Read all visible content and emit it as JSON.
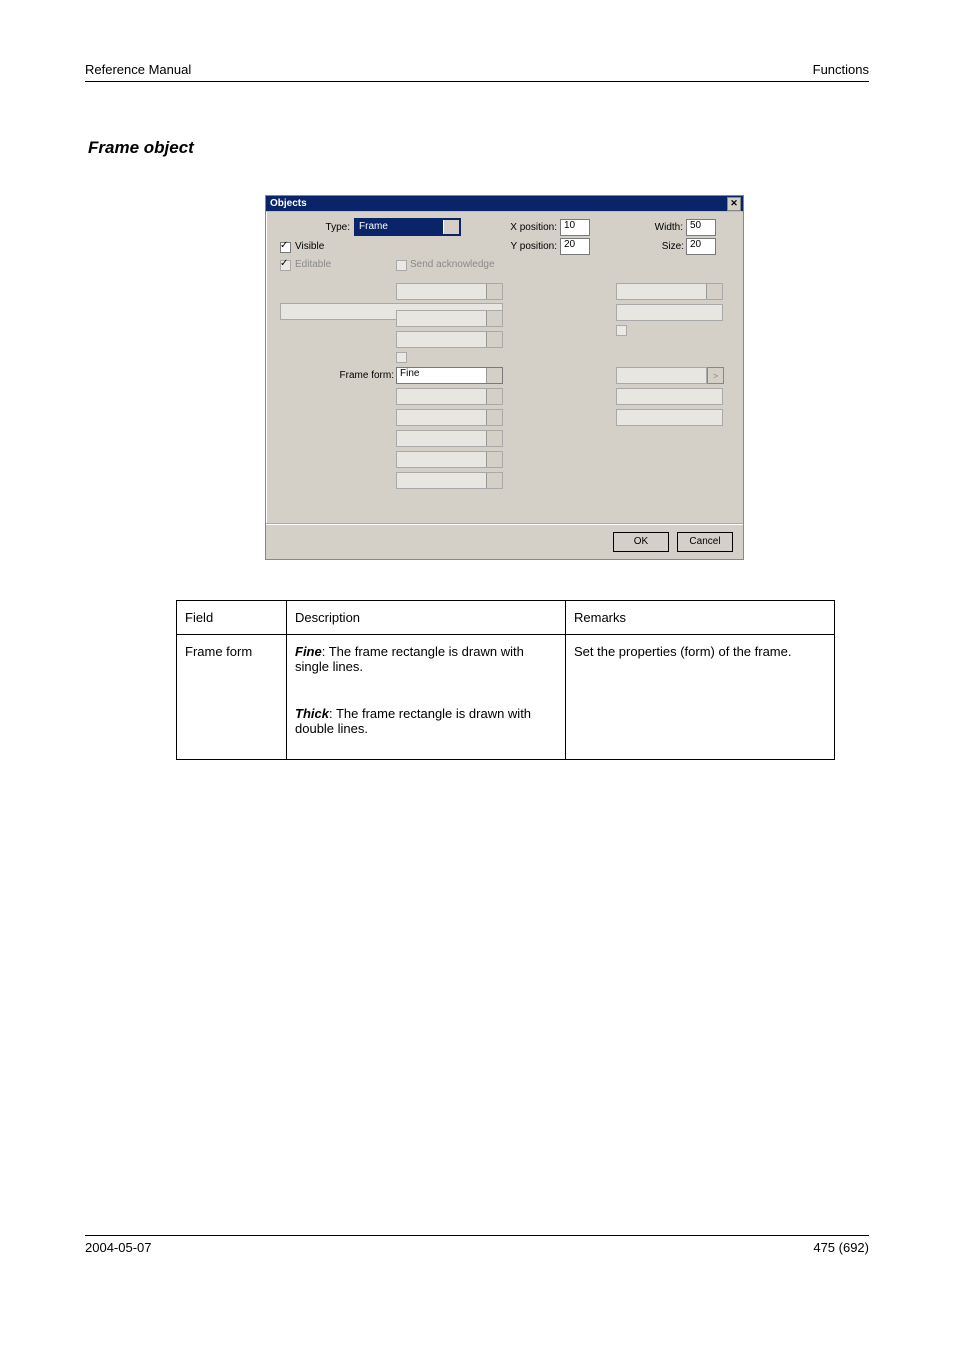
{
  "header": {
    "left": "Reference Manual",
    "right": "Functions"
  },
  "footer": {
    "left": "2004-05-07",
    "right": "475 (692)"
  },
  "section_heading": "Frame object",
  "dialog": {
    "title": "Objects",
    "labels": {
      "type": "Type:",
      "visible": "Visible",
      "editable": "Editable",
      "send_ack": "Send acknowledge",
      "xpos": "X position:",
      "ypos": "Y position:",
      "width": "Width:",
      "size": "Size:",
      "frame_form": "Frame form:"
    },
    "values": {
      "type": "Frame",
      "xpos": "10",
      "ypos": "20",
      "width": "50",
      "size": "20",
      "frame_form": "Fine"
    },
    "buttons": {
      "ok": "OK",
      "cancel": "Cancel"
    }
  },
  "table": {
    "headers": [
      "Field",
      "Description",
      "Remarks"
    ],
    "rows": [
      {
        "field": "Frame form",
        "descriptions": [
          {
            "label": "Fine",
            "text": ": The frame rectangle is drawn with single lines."
          },
          {
            "label": "Thick",
            "text": ": The frame rectangle is drawn with double lines."
          }
        ],
        "remark": "Set the properties (form) of the frame."
      }
    ]
  }
}
